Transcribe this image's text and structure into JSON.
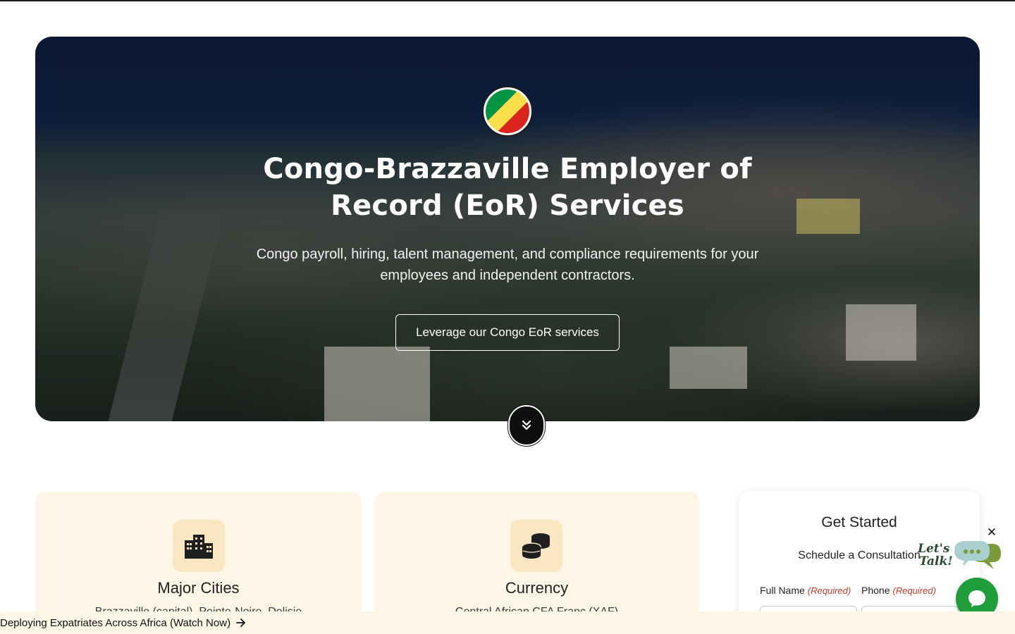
{
  "hero": {
    "title": "Congo-Brazzaville Employer of Record (EoR) Services",
    "subtitle": "Congo payroll, hiring, talent management, and compliance requirements for your employees and independent contractors.",
    "cta_label": "Leverage our Congo EoR services"
  },
  "cards": [
    {
      "title": "Major Cities",
      "text": "Brazzaville (capital), Pointe-Noire, Dolisie",
      "icon": "city-buildings-icon"
    },
    {
      "title": "Currency",
      "text": "Central African CFA Franc (XAF)",
      "icon": "coins-stack-icon"
    }
  ],
  "form": {
    "title": "Get Started",
    "subtitle": "Schedule a Consultation",
    "fields": [
      {
        "label": "Full Name",
        "required_tag": "(Required)"
      },
      {
        "label": "Phone",
        "required_tag": "(Required)"
      }
    ]
  },
  "chat": {
    "lets_talk_line1": "Let's",
    "lets_talk_line2": "Talk!",
    "close_symbol": "✕"
  },
  "bottom_bar": {
    "link_label": "Deploying Expatriates Across Africa (Watch Now)"
  },
  "colors": {
    "card_bg": "#fdf6e7",
    "icon_box_bg": "#fbe6c4",
    "required_red": "#c0392b",
    "chat_green": "#1d9e3a",
    "flag_green": "#009543",
    "flag_yellow": "#fbde4a",
    "flag_red": "#dc241f"
  }
}
